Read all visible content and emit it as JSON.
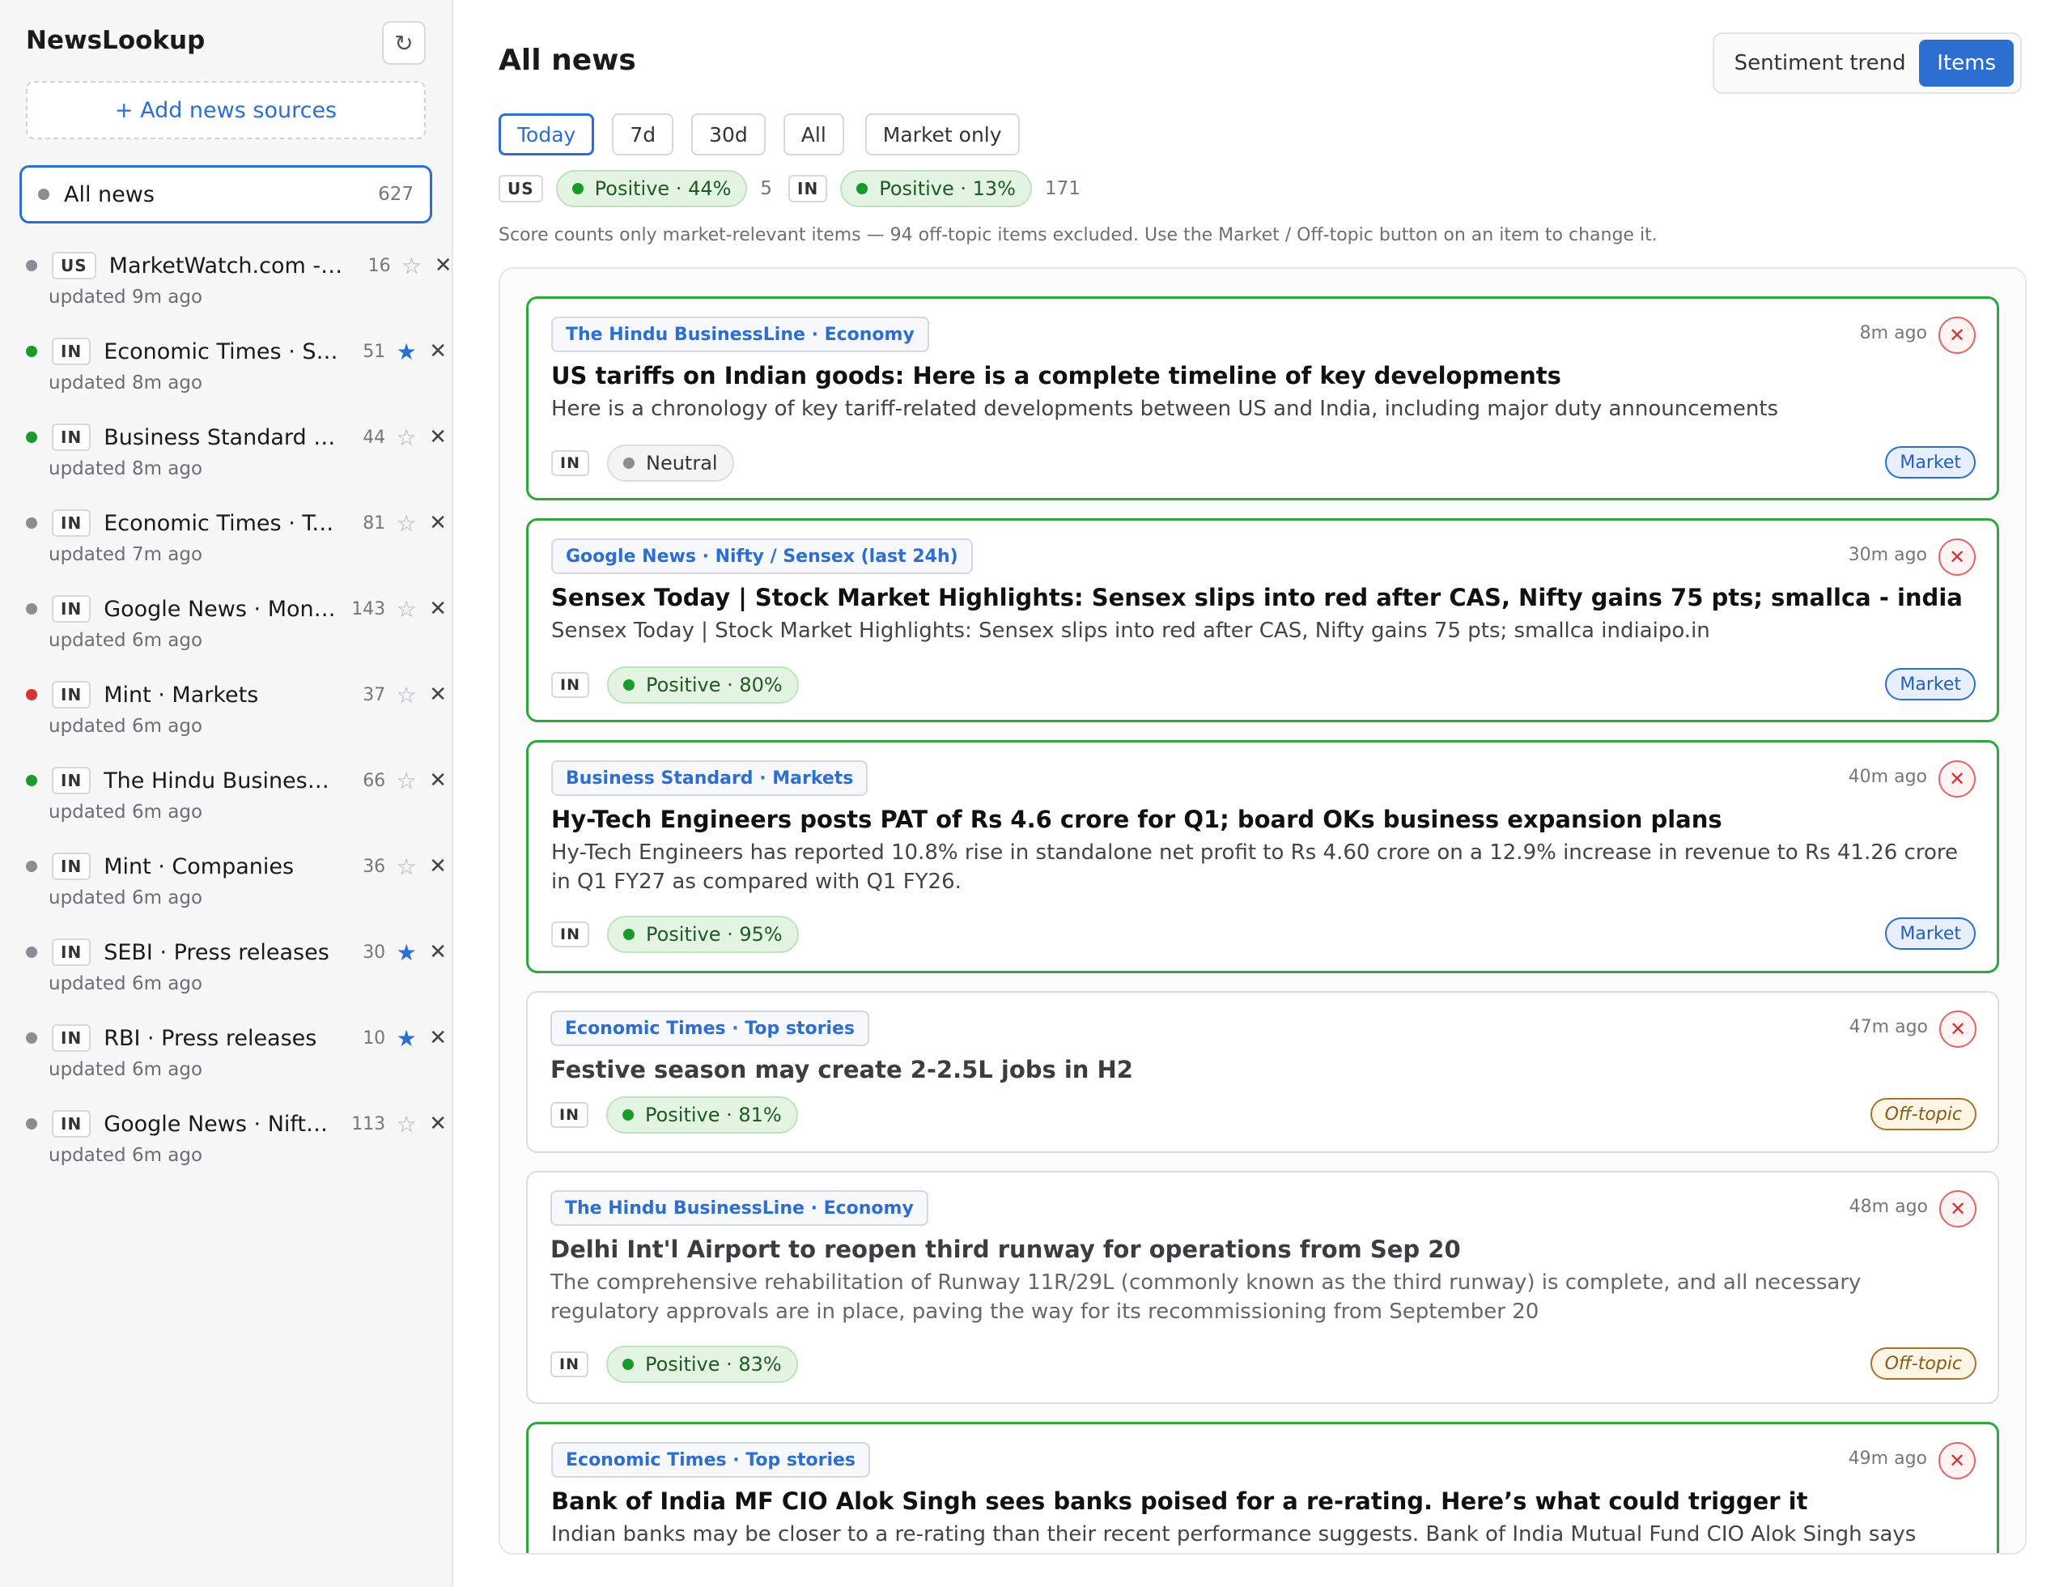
{
  "app": {
    "title": "NewsLookup",
    "refresh_icon": "↻",
    "add_sources_label": "+ Add news sources"
  },
  "sidebar": {
    "all_news": {
      "label": "All news",
      "count": "627"
    },
    "sources": [
      {
        "country": "US",
        "name": "MarketWatch.com - Top Stories",
        "count": "16",
        "starred": false,
        "updated": "updated 9m ago",
        "status_color": "#8a8d91"
      },
      {
        "country": "IN",
        "name": "Economic Times · Stocks",
        "count": "51",
        "starred": true,
        "updated": "updated 8m ago",
        "status_color": "#1a9a2a"
      },
      {
        "country": "IN",
        "name": "Business Standard · Markets",
        "count": "44",
        "starred": false,
        "updated": "updated 8m ago",
        "status_color": "#1a9a2a"
      },
      {
        "country": "IN",
        "name": "Economic Times · Top stories",
        "count": "81",
        "starred": false,
        "updated": "updated 7m ago",
        "status_color": "#8a8d91"
      },
      {
        "country": "IN",
        "name": "Google News · Money",
        "count": "143",
        "starred": false,
        "updated": "updated 6m ago",
        "status_color": "#8a8d91"
      },
      {
        "country": "IN",
        "name": "Mint · Markets",
        "count": "37",
        "starred": false,
        "updated": "updated 6m ago",
        "status_color": "#d63333"
      },
      {
        "country": "IN",
        "name": "The Hindu BusinessLine · Economy",
        "count": "66",
        "starred": false,
        "updated": "updated 6m ago",
        "status_color": "#1a9a2a"
      },
      {
        "country": "IN",
        "name": "Mint · Companies",
        "count": "36",
        "starred": false,
        "updated": "updated 6m ago",
        "status_color": "#8a8d91"
      },
      {
        "country": "IN",
        "name": "SEBI · Press releases",
        "count": "30",
        "starred": true,
        "updated": "updated 6m ago",
        "status_color": "#8a8d91"
      },
      {
        "country": "IN",
        "name": "RBI · Press releases",
        "count": "10",
        "starred": true,
        "updated": "updated 6m ago",
        "status_color": "#8a8d91"
      },
      {
        "country": "IN",
        "name": "Google News · Nifty / Sensex",
        "count": "113",
        "starred": false,
        "updated": "updated 6m ago",
        "status_color": "#8a8d91"
      }
    ]
  },
  "main": {
    "title": "All news",
    "view_toggle": {
      "sentiment_label": "Sentiment trend",
      "items_label": "Items"
    },
    "filters": [
      "Today",
      "7d",
      "30d",
      "All"
    ],
    "market_only_label": "Market only",
    "scores": [
      {
        "country": "US",
        "label": "Positive · 44%",
        "count": "5"
      },
      {
        "country": "IN",
        "label": "Positive · 13%",
        "count": "171"
      }
    ],
    "hint": "Score counts only market-relevant items — 94 off-topic items excluded. Use the Market / Off-topic button on an item to change it.",
    "items": [
      {
        "source": "The Hindu BusinessLine · Economy",
        "time": "8m ago",
        "title": "US tariffs on Indian goods: Here is a complete timeline of key developments",
        "desc": "Here is a chronology of key tariff-related developments between US and India, including major duty announcements",
        "country": "IN",
        "sentiment": "Neutral",
        "tag": "Market"
      },
      {
        "source": "Google News · Nifty / Sensex (last 24h)",
        "time": "30m ago",
        "title": "Sensex Today | Stock Market Highlights: Sensex slips into red after CAS, Nifty gains 75 pts; smallca - indiaipo.in",
        "desc": "Sensex Today | Stock Market Highlights: Sensex slips into red after CAS, Nifty gains 75 pts; smallca    indiaipo.in",
        "country": "IN",
        "sentiment": "Positive · 80%",
        "tag": "Market"
      },
      {
        "source": "Business Standard · Markets",
        "time": "40m ago",
        "title": "Hy-Tech Engineers posts PAT of Rs 4.6 crore for Q1; board OKs business expansion plans",
        "desc": "Hy-Tech Engineers has reported 10.8% rise in standalone net profit to Rs 4.60 crore on a 12.9% increase in revenue to Rs 41.26 crore in Q1 FY27 as compared with Q1 FY26.",
        "country": "IN",
        "sentiment": "Positive · 95%",
        "tag": "Market"
      },
      {
        "source": "Economic Times · Top stories",
        "time": "47m ago",
        "title": "Festive season may create 2-2.5L jobs in H2",
        "desc": "",
        "country": "IN",
        "sentiment": "Positive · 81%",
        "tag": "Off-topic"
      },
      {
        "source": "The Hindu BusinessLine · Economy",
        "time": "48m ago",
        "title": "Delhi Int'l Airport to reopen third runway for operations from Sep 20",
        "desc": "The comprehensive rehabilitation of Runway 11R/29L (commonly known as the third runway) is complete, and all necessary regulatory approvals are in place, paving the way for its recommissioning from September 20",
        "country": "IN",
        "sentiment": "Positive · 83%",
        "tag": "Off-topic"
      },
      {
        "source": "Economic Times · Top stories",
        "time": "49m ago",
        "title": "Bank of India MF CIO Alok Singh sees banks poised for a re-rating. Here’s what could trigger it",
        "desc": "Indian banks may be closer to a re-rating than their recent performance suggests. Bank of India Mutual Fund CIO Alok Singh says lenders have",
        "country": "IN",
        "sentiment": "",
        "tag": ""
      }
    ],
    "close_icon": "✕"
  },
  "icons": {
    "star_on": "★",
    "star_off": "☆",
    "remove": "✕"
  }
}
